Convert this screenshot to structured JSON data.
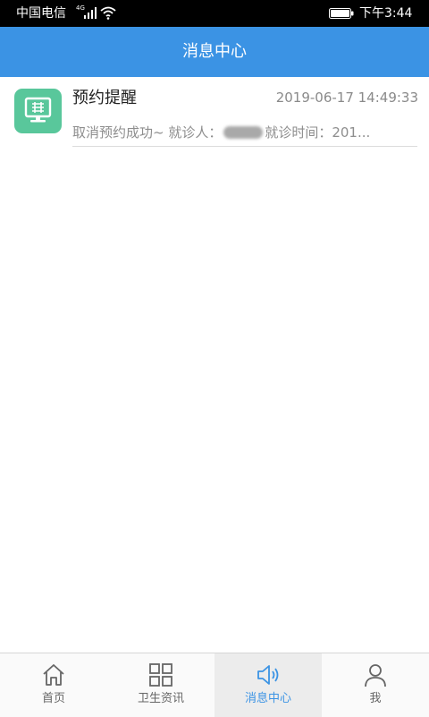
{
  "status_bar": {
    "carrier": "中国电信",
    "network": "4G",
    "time": "下午3:44"
  },
  "header": {
    "title": "消息中心"
  },
  "messages": [
    {
      "title": "预约提醒",
      "time": "2019-06-17 14:49:33",
      "preview_prefix": "取消预约成功~ 就诊人：",
      "preview_suffix": "就诊时间：201..."
    }
  ],
  "bottom_nav": {
    "items": [
      {
        "label": "首页",
        "icon": "home-icon"
      },
      {
        "label": "卫生资讯",
        "icon": "grid-icon"
      },
      {
        "label": "消息中心",
        "icon": "speaker-icon",
        "active": true
      },
      {
        "label": "我",
        "icon": "user-icon"
      }
    ]
  },
  "colors": {
    "primary": "#3b93e4",
    "message_icon": "#59c79b"
  }
}
